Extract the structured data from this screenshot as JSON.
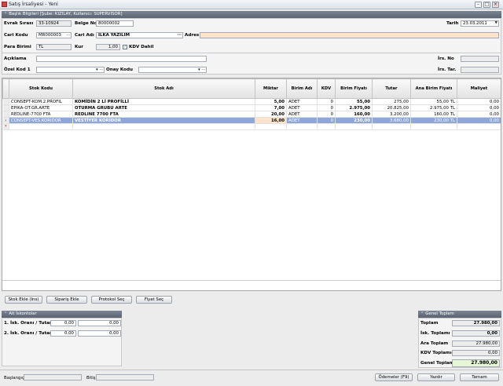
{
  "window": {
    "title": "Satış İrsaliyesi - Yeni"
  },
  "header_section": {
    "title": "Başlık Bilgileri [Şube: KIZILAY, Kullanıcı: SUPERVISOR]"
  },
  "form": {
    "evrak_sirasi_label": "Evrak Sırası",
    "evrak_sirasi": "33-10924",
    "belge_no_label": "Belge No",
    "belge_no": "80000002",
    "tarih_label": "Tarih",
    "tarih": "23.03.2011",
    "cari_kodu_label": "Cari Kodu",
    "cari_kodu": "MR000003",
    "cari_adi_label": "Cari Adı",
    "cari_adi": "İLKA YAZILIM",
    "adres_label": "Adres",
    "adres": "",
    "para_birimi_label": "Para Birimi",
    "para_birimi": "TL",
    "kur_label": "Kur",
    "kur": "1,00",
    "kdv_dahil_label": "KDV Dahil",
    "aciklama_label": "Açıklama",
    "aciklama": "",
    "ozel_kod_label": "Özel Kod 1",
    "ozel_kod": "",
    "onay_kodu_label": "Onay Kodu",
    "onay_kodu": "",
    "irs_no_label": "İrs. No",
    "irs_no": "",
    "irs_tar_label": "İrs. Tar.",
    "irs_tar": ""
  },
  "grid": {
    "columns": [
      "Stok Kodu",
      "Stok Adı",
      "Miktar",
      "Birim Adı",
      "KDV",
      "Birim Fiyatı",
      "Tutar",
      "Ana Birim Fiyatı",
      "Maliyet"
    ],
    "rows": [
      {
        "kod": "CONSEPT-KOM.2.PROFIL",
        "ad": "KOMİDİN 2 Lİ PROFİLLİ",
        "miktar": "5,00",
        "birim": "ADET",
        "kdv": "0",
        "fiyat": "55,00",
        "tutar": "275,00",
        "ana": "55,00 TL",
        "maliyet": "0,00"
      },
      {
        "kod": "EPIKA-OT.GR.ARTE",
        "ad": "OTURMA GRUBU ARTE",
        "miktar": "7,00",
        "birim": "ADET",
        "kdv": "0",
        "fiyat": "2.975,00",
        "tutar": "20.825,00",
        "ana": "2.975,00 TL",
        "maliyet": "0,00"
      },
      {
        "kod": "REDLINE-7700 FTA",
        "ad": "REDLINE 7700 FTA",
        "miktar": "20,00",
        "birim": "ADET",
        "kdv": "0",
        "fiyat": "160,00",
        "tutar": "3.200,00",
        "ana": "160,00 TL",
        "maliyet": "0,00"
      },
      {
        "kod": "CONSEPT-VES.KORIDOR",
        "ad": "VESTİYER KORİDOR",
        "miktar": "16,00",
        "birim": "ADET",
        "kdv": "0",
        "fiyat": "230,00",
        "tutar": "3.680,00",
        "ana": "230,00 TL",
        "maliyet": "0,00"
      }
    ]
  },
  "buttons": {
    "stok_ekle": "Stok Ekle (Ins)",
    "siparis_ekle": "Sipariş Ekle",
    "protokol_sec": "Protokol Seç",
    "fiyat_sec": "Fiyat Seç",
    "odemeler": "Ödemeler (F9)",
    "yazdir": "Yazdır",
    "tamam": "Tamam"
  },
  "alt_iskontolar": {
    "title": "Alt İskontolar",
    "row1_label": "1. İsk. Oranı / Tutarı",
    "row1_rate": "0,00",
    "row1_amount": "0,00",
    "row2_label": "2. İsk. Oranı / Tutarı",
    "row2_rate": "0,00",
    "row2_amount": "0,00"
  },
  "genel_toplam": {
    "title": "Genel Toplam",
    "toplam_label": "Toplam",
    "toplam": "27.980,00",
    "isk_label": "İsk. Toplamı",
    "isk": "0,00",
    "ara_label": "Ara Toplam",
    "ara": "27.980,00",
    "kdv_label": "KDV Toplamı",
    "kdv": "0,00",
    "genel_label": "Genel Toplam",
    "genel": "27.980,00"
  },
  "footer": {
    "baslangic_label": "Başlangıç",
    "baslangic": "",
    "bitis_label": "Bitiş",
    "bitis": ""
  },
  "colors": {
    "selection": "#8ea6d8",
    "peach": "#fde3cc",
    "header": "#5a6473"
  }
}
